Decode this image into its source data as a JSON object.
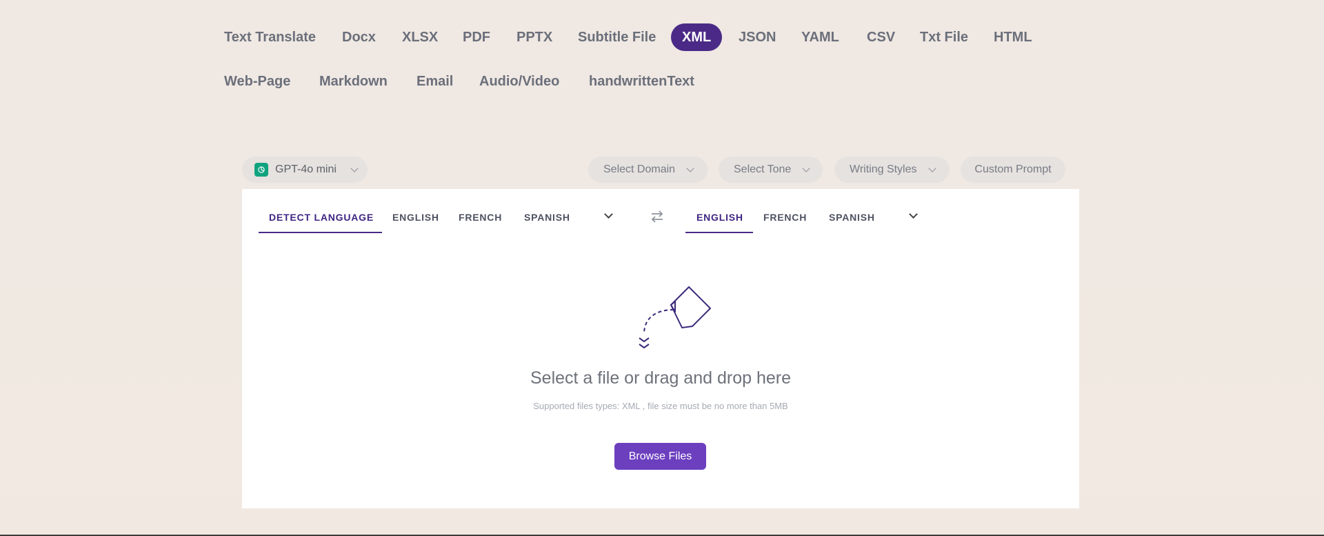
{
  "file_tabs": [
    {
      "label": "Text Translate",
      "active": false
    },
    {
      "label": "Docx",
      "active": false
    },
    {
      "label": "XLSX",
      "active": false
    },
    {
      "label": "PDF",
      "active": false
    },
    {
      "label": "PPTX",
      "active": false
    },
    {
      "label": "Subtitle File",
      "active": false
    },
    {
      "label": "XML",
      "active": true
    },
    {
      "label": "JSON",
      "active": false
    },
    {
      "label": "YAML",
      "active": false
    },
    {
      "label": "CSV",
      "active": false
    },
    {
      "label": "Txt File",
      "active": false
    },
    {
      "label": "HTML",
      "active": false
    },
    {
      "label": "Web-Page",
      "active": false
    },
    {
      "label": "Markdown",
      "active": false
    },
    {
      "label": "Email",
      "active": false
    },
    {
      "label": "Audio/Video",
      "active": false
    },
    {
      "label": "handwrittenText",
      "active": false
    }
  ],
  "controls": {
    "model": "GPT-4o mini",
    "domain": "Select Domain",
    "tone": "Select Tone",
    "styles": "Writing Styles",
    "custom_prompt": "Custom Prompt"
  },
  "source_langs": [
    {
      "label": "DETECT LANGUAGE",
      "active": true
    },
    {
      "label": "ENGLISH",
      "active": false
    },
    {
      "label": "FRENCH",
      "active": false
    },
    {
      "label": "SPANISH",
      "active": false
    }
  ],
  "target_langs": [
    {
      "label": "ENGLISH",
      "active": true
    },
    {
      "label": "FRENCH",
      "active": false
    },
    {
      "label": "SPANISH",
      "active": false
    }
  ],
  "dropzone": {
    "title": "Select a file or drag and drop here",
    "subtitle": "Supported files types: XML , file size must be no more than 5MB",
    "button": "Browse Files"
  },
  "colors": {
    "accent": "#4a2a86",
    "button": "#6c3fbf",
    "model_logo": "#10a37f"
  },
  "icons": [
    "openai-icon",
    "chevron-down-icon",
    "swap-arrows-icon",
    "file-pour-icon"
  ]
}
